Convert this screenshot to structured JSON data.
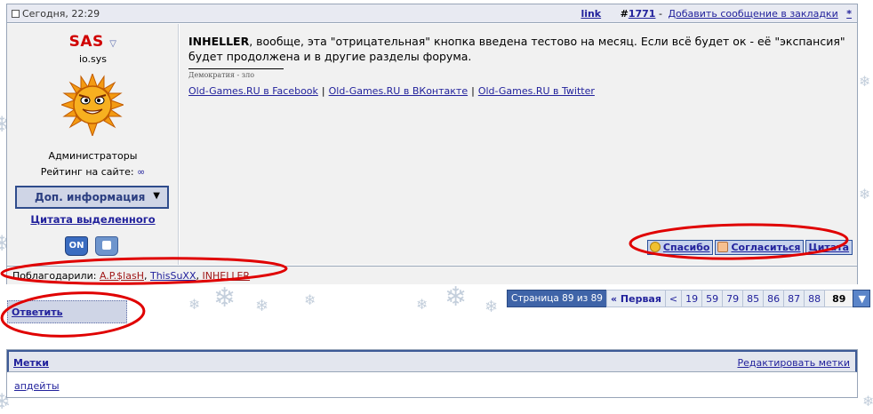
{
  "post": {
    "date": "Сегодня, 22:29",
    "link_label": "link",
    "post_hash": "#",
    "post_number": "1771",
    "bookmark_label": "Добавить сообщение в закладки",
    "star": "*"
  },
  "user": {
    "name": "SAS",
    "title": "io.sys",
    "role": "Администраторы",
    "rating_label": "Рейтинг на сайте:",
    "rating_value": "∞",
    "info_button": "Доп. информация",
    "quote_selected": "Цитата выделенного",
    "online_badge": "ON"
  },
  "message": {
    "author": "INHELLER",
    "text": ", вообще, эта \"отрицательная\" кнопка введена тестово на месяц. Если всё будет ок - её \"экспансия\" будет продолжена и в другие разделы форума.",
    "signature_small": "Демократия - зло",
    "links": [
      "Old-Games.RU в Facebook",
      "Old-Games.RU в ВКонтакте",
      "Old-Games.RU в Twitter"
    ],
    "link_separator": "|"
  },
  "actions": {
    "thanks": "Спасибо",
    "agree": "Согласиться",
    "quote": "Цитата"
  },
  "thanks_row": {
    "label": "Поблагодарили:",
    "users": [
      "A.P.$lasH",
      "ThisSuXX",
      "INHELLER"
    ],
    "separator": ","
  },
  "reply_button": "Ответить",
  "pager": {
    "label": "Страница 89 из 89",
    "first": "« Первая",
    "prev": "<",
    "pages": [
      "19",
      "59",
      "79",
      "85",
      "86",
      "87",
      "88"
    ],
    "current": "89"
  },
  "tags": {
    "title": "Метки",
    "edit": "Редактировать метки",
    "items": [
      "апдейты"
    ]
  },
  "colors": {
    "accent": "#2a4f9a",
    "link": "#22229c",
    "username": "#d00000",
    "annotation": "#e00000"
  }
}
